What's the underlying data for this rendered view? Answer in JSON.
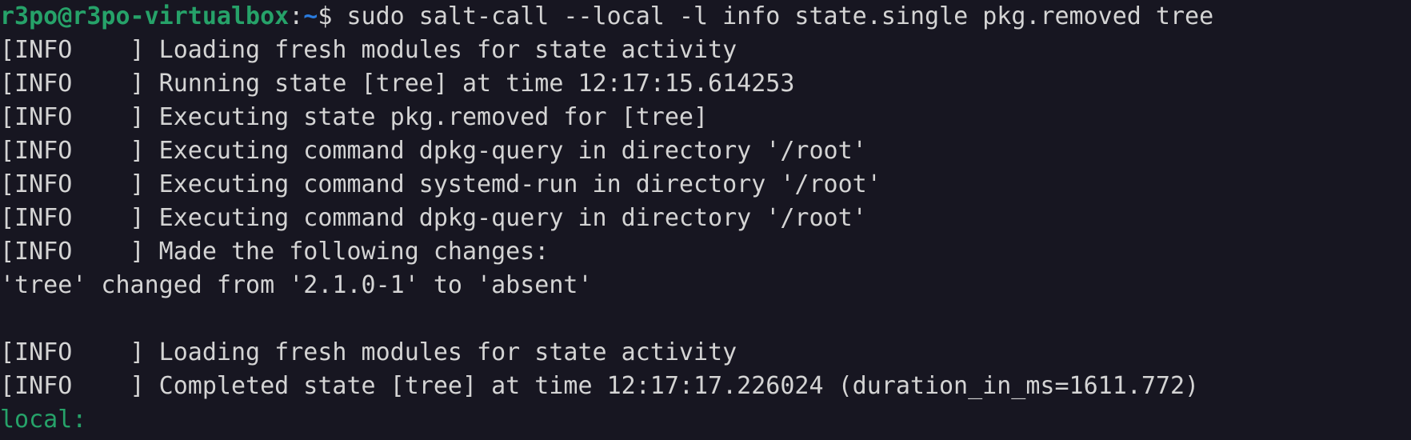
{
  "prompt": {
    "user_host": "r3po@r3po-virtualbox",
    "colon": ":",
    "path": "~",
    "symbol": "$ ",
    "command": "sudo salt-call --local -l info state.single pkg.removed tree"
  },
  "output": [
    "[INFO    ] Loading fresh modules for state activity",
    "[INFO    ] Running state [tree] at time 12:17:15.614253",
    "[INFO    ] Executing state pkg.removed for [tree]",
    "[INFO    ] Executing command dpkg-query in directory '/root'",
    "[INFO    ] Executing command systemd-run in directory '/root'",
    "[INFO    ] Executing command dpkg-query in directory '/root'",
    "[INFO    ] Made the following changes:",
    "'tree' changed from '2.1.0-1' to 'absent'",
    "",
    "[INFO    ] Loading fresh modules for state activity",
    "[INFO    ] Completed state [tree] at time 12:17:17.226024 (duration_in_ms=1611.772)"
  ],
  "result_label": "local:",
  "colors": {
    "background": "#171621",
    "text": "#d4d4d4",
    "user": "#26a269",
    "path": "#2a7bde"
  }
}
